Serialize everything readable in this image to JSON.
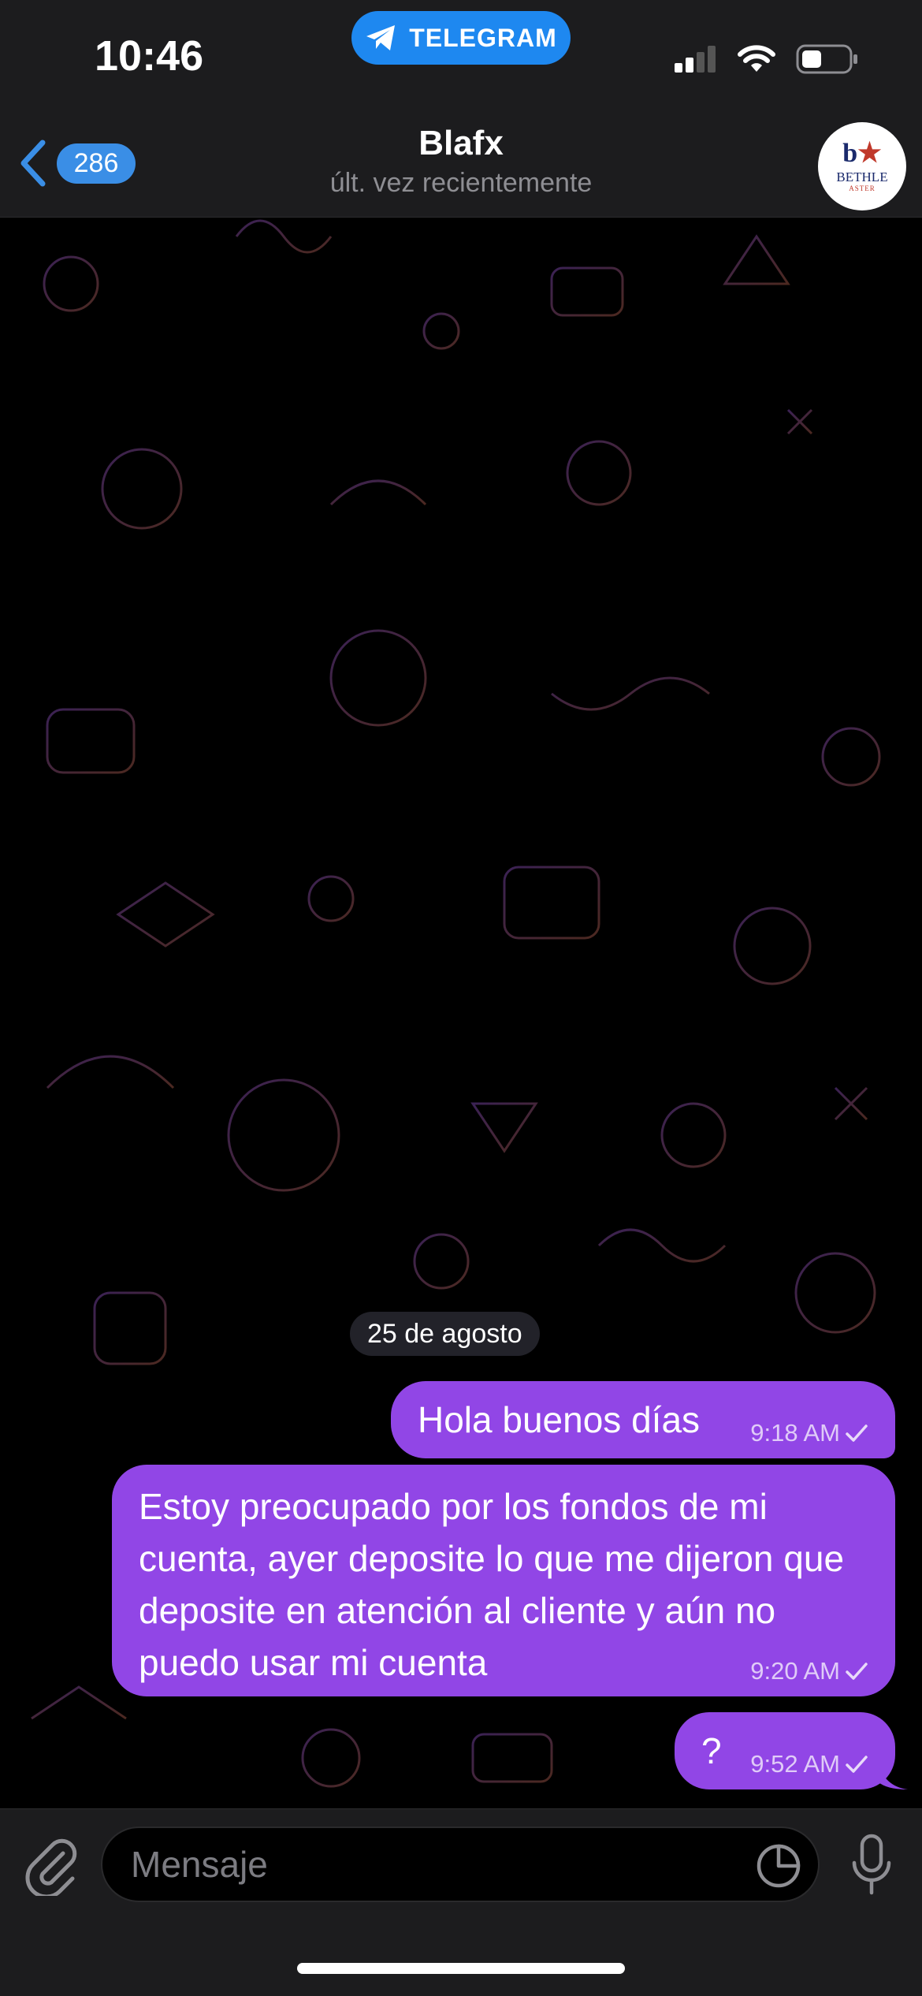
{
  "status_bar": {
    "time": "10:46",
    "app_pill": "TELEGRAM"
  },
  "header": {
    "back_count": "286",
    "title": "Blafx",
    "subtitle": "últ. vez recientemente",
    "avatar_text": "BETHLE",
    "avatar_sub": "ASTER"
  },
  "chat": {
    "date_label": "25 de agosto",
    "messages": [
      {
        "text": "Hola buenos días",
        "time": "9:18 AM",
        "status": "sent"
      },
      {
        "text": "Estoy preocupado por los fondos de mi cuenta, ayer deposite lo que me dijeron que deposite en atención al cliente y aún no puedo usar mi cuenta",
        "time": "9:20 AM",
        "status": "sent"
      },
      {
        "text": "?",
        "time": "9:52 AM",
        "status": "sent"
      }
    ]
  },
  "composer": {
    "placeholder": "Mensaje"
  },
  "colors": {
    "bubble": "#9146e6",
    "accent": "#3a8ee6",
    "bar_bg": "#1c1c1e"
  },
  "icons": [
    "back-chevron-icon",
    "telegram-plane-icon",
    "signal-icon",
    "wifi-icon",
    "battery-icon",
    "paperclip-icon",
    "sticker-icon",
    "microphone-icon",
    "checkmark-icon"
  ]
}
